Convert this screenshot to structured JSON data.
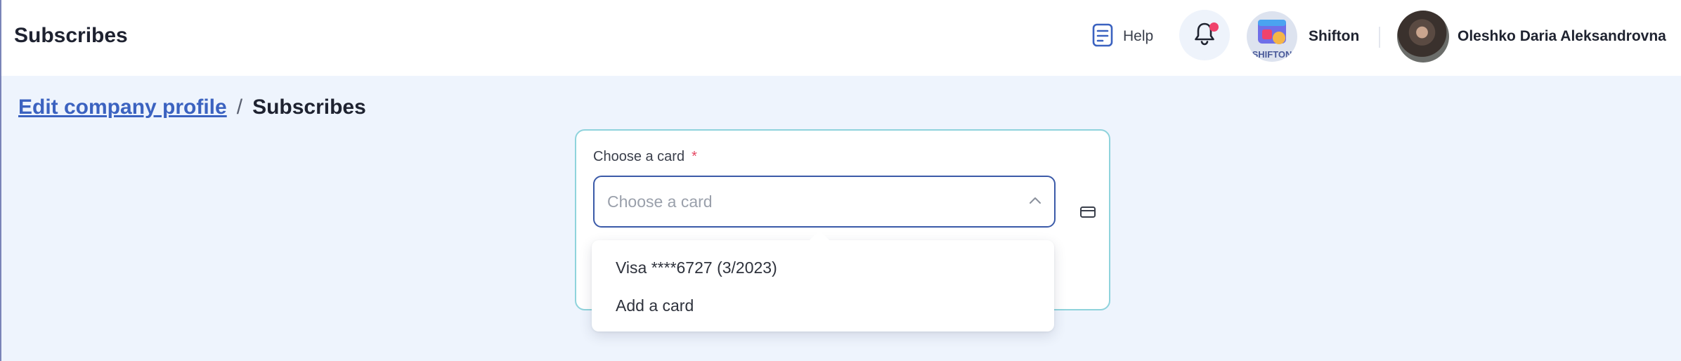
{
  "header": {
    "title": "Subscribes",
    "help_label": "Help",
    "company_name": "Shifton",
    "company_logo_text": "SHIFTON",
    "user_name": "Oleshko Daria Aleksandrovna"
  },
  "breadcrumb": {
    "parent": "Edit company profile",
    "separator": "/",
    "current": "Subscribes"
  },
  "card_form": {
    "label": "Choose a card",
    "required_mark": "*",
    "placeholder": "Choose a card",
    "options": [
      {
        "label": "Visa ****6727 (3/2023)"
      },
      {
        "label": "Add a card"
      }
    ]
  },
  "colors": {
    "accent": "#3b62c0",
    "notification_dot": "#f0426b",
    "panel_border": "#8fd3dc",
    "page_background": "#eef4fd"
  },
  "icons": {
    "help": "document-icon",
    "notifications": "bell-icon",
    "select": "chevron-up-icon",
    "card": "credit-card-icon"
  }
}
